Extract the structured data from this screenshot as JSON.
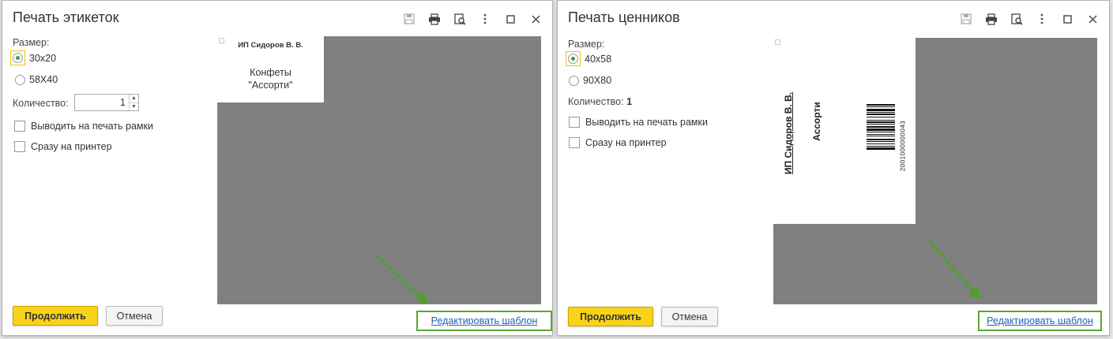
{
  "labels_dialog": {
    "title": "Печать этикеток",
    "size_label": "Размер:",
    "sizes": [
      "30x20",
      "58X40"
    ],
    "selected_size": "30x20",
    "quantity_label": "Количество:",
    "quantity_value": "1",
    "print_frames_label": "Выводить на печать рамки",
    "direct_print_label": "Сразу на принтер",
    "label_preview": {
      "seller": "ИП Сидоров В. В.",
      "product_line1": "Конфеты",
      "product_line2": "\"Ассорти\""
    },
    "continue_button": "Продолжить",
    "cancel_button": "Отмена",
    "edit_template_link": "Редактировать шаблон"
  },
  "price_tags_dialog": {
    "title": "Печать ценников",
    "size_label": "Размер:",
    "sizes": [
      "40x58",
      "90X80"
    ],
    "selected_size": "40x58",
    "quantity_label": "Количество:",
    "quantity_value": "1",
    "print_frames_label": "Выводить на печать рамки",
    "direct_print_label": "Сразу на принтер",
    "tag_preview": {
      "seller": "ИП Сидоров В. В.",
      "product": "Ассорти",
      "barcode_digits": "2001000000043"
    },
    "continue_button": "Продолжить",
    "cancel_button": "Отмена",
    "edit_template_link": "Редактировать шаблон"
  },
  "colors": {
    "primary_button": "#f9d21a",
    "highlight_frame": "#5aa832",
    "radio_selected": "#3d9a5a",
    "preview_background": "#808080",
    "link": "#1d5fb8"
  }
}
